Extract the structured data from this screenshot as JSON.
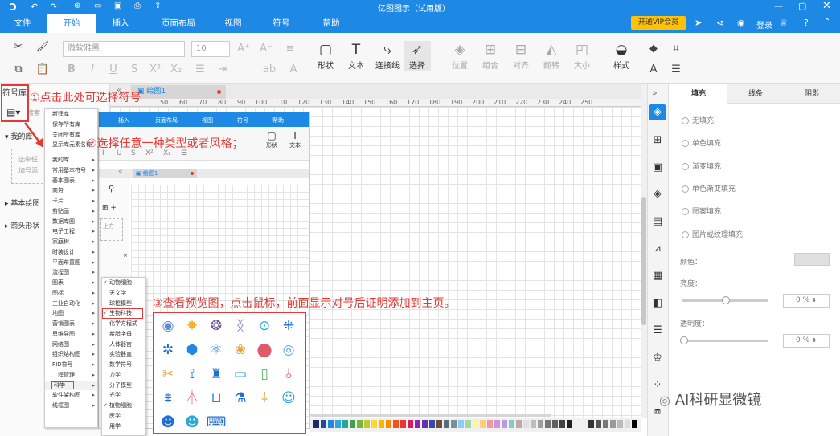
{
  "app": {
    "title": "亿图图示（试用版）"
  },
  "menu": {
    "tabs": [
      "文件",
      "开始",
      "插入",
      "页面布局",
      "视图",
      "符号",
      "帮助"
    ],
    "vip": "开通VIP会员",
    "login": "登录"
  },
  "toolbar": {
    "font_name": "微软雅黑",
    "font_size": "10",
    "shape": "形状",
    "text": "文本",
    "connector": "连接线",
    "select": "选择",
    "position": "位置",
    "group": "组合",
    "align": "对齐",
    "flip": "翻转",
    "size": "大小",
    "style": "样式"
  },
  "left": {
    "symbol_lib": "符号库",
    "search_placeholder": "搜索",
    "my_lib": "我的库",
    "drop_hint_1": "选中任",
    "drop_hint_2": "加号添",
    "basic": "基本绘图",
    "arrow": "箭头形状"
  },
  "doc": {
    "tab": "绘图1"
  },
  "popup1": {
    "items": [
      {
        "label": "新建库",
        "arrow": false
      },
      {
        "label": "保存所有库",
        "arrow": false
      },
      {
        "label": "关闭所有库",
        "arrow": false
      },
      {
        "label": "显示库元素名称",
        "arrow": false
      },
      {
        "label": "我的库",
        "arrow": true
      },
      {
        "label": "常用基本符号",
        "arrow": true
      },
      {
        "label": "基本图表",
        "arrow": true
      },
      {
        "label": "商务",
        "arrow": true
      },
      {
        "label": "卡片",
        "arrow": true
      },
      {
        "label": "剪贴画",
        "arrow": true
      },
      {
        "label": "数据库图",
        "arrow": true
      },
      {
        "label": "电子工程",
        "arrow": true
      },
      {
        "label": "家庭树",
        "arrow": true
      },
      {
        "label": "时装设计",
        "arrow": true
      },
      {
        "label": "平面布置图",
        "arrow": true
      },
      {
        "label": "流程图",
        "arrow": true
      },
      {
        "label": "图表",
        "arrow": true
      },
      {
        "label": "图标",
        "arrow": true
      },
      {
        "label": "工业自动化",
        "arrow": true
      },
      {
        "label": "地图",
        "arrow": true
      },
      {
        "label": "营销图表",
        "arrow": true
      },
      {
        "label": "思维导图",
        "arrow": true
      },
      {
        "label": "网络图",
        "arrow": true
      },
      {
        "label": "组织结构图",
        "arrow": true
      },
      {
        "label": "PID符号",
        "arrow": true
      },
      {
        "label": "工程管理",
        "arrow": true
      },
      {
        "label": "科学",
        "arrow": true
      },
      {
        "label": "软件架构图",
        "arrow": true
      },
      {
        "label": "线框图",
        "arrow": true
      }
    ]
  },
  "popup2": {
    "items": [
      {
        "label": "动物细胞",
        "checked": true
      },
      {
        "label": "天文学",
        "checked": false
      },
      {
        "label": "球棍模型",
        "checked": false
      },
      {
        "label": "生物科技",
        "checked": true
      },
      {
        "label": "化学方程式",
        "checked": false
      },
      {
        "label": "希腊字母",
        "checked": false
      },
      {
        "label": "人体器官",
        "checked": false
      },
      {
        "label": "实验器皿",
        "checked": false
      },
      {
        "label": "数学符号",
        "checked": false
      },
      {
        "label": "力学",
        "checked": false
      },
      {
        "label": "分子模型",
        "checked": false
      },
      {
        "label": "光学",
        "checked": false
      },
      {
        "label": "植物细胞",
        "checked": true
      },
      {
        "label": "医学",
        "checked": false
      },
      {
        "label": "用学",
        "checked": false
      }
    ]
  },
  "inner": {
    "tabs": [
      "插入",
      "页面布局",
      "视图",
      "符号",
      "帮助"
    ],
    "shape": "形状",
    "text": "文本",
    "doc_tab": "绘图1",
    "placeholder": "上方"
  },
  "annotations": {
    "a1": "①点击此处可选择符号",
    "a2": "②选择任意一种类型或者风格；",
    "a3": "③查看预览图，点击鼠标，前面显示对号后证明添加到主页。"
  },
  "right": {
    "tabs": [
      "填充",
      "线条",
      "阴影"
    ],
    "fills": [
      "无填充",
      "单色填充",
      "渐变填充",
      "单色渐变填充",
      "图案填充",
      "图片或纹理填充"
    ],
    "color_label": "颜色：",
    "brightness_label": "亮度：",
    "brightness_value": "0 %",
    "transparency_label": "透明度：",
    "transparency_value": "0 %"
  },
  "ruler_top": [
    "50",
    "60",
    "70",
    "80",
    "90",
    "100",
    "110",
    "120",
    "130",
    "140",
    "150",
    "160",
    "170",
    "180",
    "190",
    "200",
    "210",
    "220",
    "230",
    "240",
    "250"
  ],
  "icons": [
    "brain-icon",
    "neuron-icon",
    "ring-icon",
    "dna-icon",
    "cell-icon",
    "molecule-icon",
    "network-icon",
    "hexagon-icon",
    "atom-icon",
    "bacteria-icon",
    "egg-cell-icon",
    "petri-icon",
    "scissors-icon",
    "syringe-icon",
    "microscope-icon",
    "pill-icon",
    "test-tube-icon",
    "pipette-icon",
    "test-tube-rack-icon",
    "flask-icon",
    "beaker-icon",
    "lab-set-icon",
    "dropper-icon",
    "scientist-icon",
    "researcher-icon",
    "reader-icon",
    "laptop-icon"
  ],
  "watermark": "AI科研显微镜",
  "colors": {
    "accent": "#1e88e5",
    "annotation": "#e53935"
  }
}
